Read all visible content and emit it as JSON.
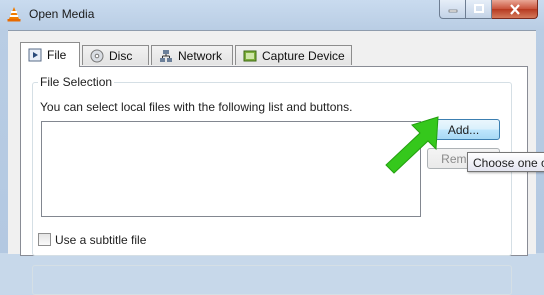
{
  "window": {
    "title": "Open Media",
    "icon": "vlc-cone-icon",
    "accent_color": "#b9cde4"
  },
  "tabs": [
    {
      "label": "File",
      "icon": "file-icon",
      "active": true
    },
    {
      "label": "Disc",
      "icon": "disc-icon",
      "active": false
    },
    {
      "label": "Network",
      "icon": "network-icon",
      "active": false
    },
    {
      "label": "Capture Device",
      "icon": "capture-device-icon",
      "active": false
    }
  ],
  "file_selection": {
    "group_title": "File Selection",
    "hint": "You can select local files with the following list and buttons.",
    "add_label": "Add...",
    "remove_label": "Remove",
    "tooltip": "Choose one or more media files"
  },
  "subtitle": {
    "checkbox_label": "Use a subtitle file",
    "checked": false
  },
  "annotation": {
    "arrow_color": "#35c81c"
  }
}
